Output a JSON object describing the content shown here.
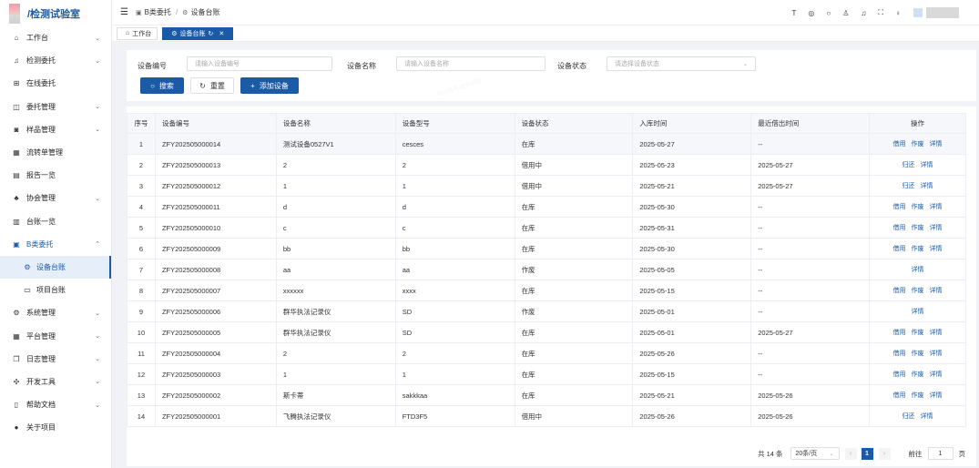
{
  "app": {
    "logo_text": "/检测试验室"
  },
  "sidebar": {
    "items": [
      {
        "label": "工作台",
        "icon": "home-icon",
        "glyph": "⌂",
        "chev": "⌄"
      },
      {
        "label": "检测委托",
        "icon": "bell-icon",
        "glyph": "♫",
        "chev": "⌄"
      },
      {
        "label": "在线委托",
        "icon": "grid-icon",
        "glyph": "⊞",
        "chev": ""
      },
      {
        "label": "委托管理",
        "icon": "bag-icon",
        "glyph": "◫",
        "chev": "⌄"
      },
      {
        "label": "样品管理",
        "icon": "camera-icon",
        "glyph": "◙",
        "chev": "⌄"
      },
      {
        "label": "流转单管理",
        "icon": "apps-icon",
        "glyph": "▦",
        "chev": ""
      },
      {
        "label": "报告一览",
        "icon": "file-icon",
        "glyph": "▤",
        "chev": ""
      },
      {
        "label": "协会管理",
        "icon": "org-icon",
        "glyph": "♣",
        "chev": "⌄"
      },
      {
        "label": "台账一览",
        "icon": "list-icon",
        "glyph": "▥",
        "chev": ""
      },
      {
        "label": "B类委托",
        "icon": "table-icon",
        "glyph": "▣",
        "chev": "⌃"
      }
    ],
    "sub_items": [
      {
        "label": "设备台账",
        "icon": "gear-icon",
        "glyph": "⚙"
      },
      {
        "label": "项目台账",
        "icon": "folder-icon",
        "glyph": "▭"
      }
    ],
    "items_after": [
      {
        "label": "系统管理",
        "icon": "settings-icon",
        "glyph": "⚙",
        "chev": "⌄"
      },
      {
        "label": "平台管理",
        "icon": "apps-icon",
        "glyph": "▦",
        "chev": "⌄"
      },
      {
        "label": "日志管理",
        "icon": "copy-icon",
        "glyph": "❐",
        "chev": "⌄"
      },
      {
        "label": "开发工具",
        "icon": "tool-icon",
        "glyph": "✣",
        "chev": "⌄"
      },
      {
        "label": "帮助文档",
        "icon": "doc-icon",
        "glyph": "▯",
        "chev": "⌄"
      },
      {
        "label": "关于项目",
        "icon": "info-icon",
        "glyph": "●",
        "chev": ""
      }
    ]
  },
  "topbar": {
    "breadcrumb_1": "B类委托",
    "breadcrumb_sep": "/",
    "breadcrumb_2": "设备台账"
  },
  "tabs": {
    "home": "工作台",
    "current": "设备台账"
  },
  "filter": {
    "code_label": "设备编号",
    "code_placeholder": "请输入设备编号",
    "name_label": "设备名称",
    "name_placeholder": "请输入设备名称",
    "status_label": "设备状态",
    "status_placeholder": "请选择设备状态",
    "search_btn": "搜索",
    "reset_btn": "重置",
    "add_btn": "添加设备"
  },
  "table": {
    "headers": [
      "序号",
      "设备编号",
      "设备名称",
      "设备型号",
      "设备状态",
      "入库时间",
      "最近借出时间",
      "操作"
    ],
    "rows": [
      {
        "no": "1",
        "code": "ZFY202505000014",
        "name": "测试设备0527V1",
        "model": "cesces",
        "status": "在库",
        "in_date": "2025-05-27",
        "lend_date": "--",
        "ops": [
          "借用",
          "作废",
          "详情"
        ]
      },
      {
        "no": "2",
        "code": "ZFY202505000013",
        "name": "2",
        "model": "2",
        "status": "借用中",
        "in_date": "2025-05-23",
        "lend_date": "2025-05-27",
        "ops": [
          "归还",
          "详情"
        ]
      },
      {
        "no": "3",
        "code": "ZFY202505000012",
        "name": "1",
        "model": "1",
        "status": "借用中",
        "in_date": "2025-05-21",
        "lend_date": "2025-05-27",
        "ops": [
          "归还",
          "详情"
        ]
      },
      {
        "no": "4",
        "code": "ZFY202505000011",
        "name": "d",
        "model": "d",
        "status": "在库",
        "in_date": "2025-05-30",
        "lend_date": "--",
        "ops": [
          "借用",
          "作废",
          "详情"
        ]
      },
      {
        "no": "5",
        "code": "ZFY202505000010",
        "name": "c",
        "model": "c",
        "status": "在库",
        "in_date": "2025-05-31",
        "lend_date": "--",
        "ops": [
          "借用",
          "作废",
          "详情"
        ]
      },
      {
        "no": "6",
        "code": "ZFY202505000009",
        "name": "bb",
        "model": "bb",
        "status": "在库",
        "in_date": "2025-05-30",
        "lend_date": "--",
        "ops": [
          "借用",
          "作废",
          "详情"
        ]
      },
      {
        "no": "7",
        "code": "ZFY202505000008",
        "name": "aa",
        "model": "aa",
        "status": "作废",
        "in_date": "2025-05-05",
        "lend_date": "--",
        "ops": [
          "详情"
        ]
      },
      {
        "no": "8",
        "code": "ZFY202505000007",
        "name": "xxxxxx",
        "model": "xxxx",
        "status": "在库",
        "in_date": "2025-05-15",
        "lend_date": "--",
        "ops": [
          "借用",
          "作废",
          "详情"
        ]
      },
      {
        "no": "9",
        "code": "ZFY202505000006",
        "name": "群华执法记录仪",
        "model": "SD",
        "status": "作废",
        "in_date": "2025-05-01",
        "lend_date": "--",
        "ops": [
          "详情"
        ]
      },
      {
        "no": "10",
        "code": "ZFY202505000005",
        "name": "群华执法记录仪",
        "model": "SD",
        "status": "在库",
        "in_date": "2025-05-01",
        "lend_date": "2025-05-27",
        "ops": [
          "借用",
          "作废",
          "详情"
        ]
      },
      {
        "no": "11",
        "code": "ZFY202505000004",
        "name": "2",
        "model": "2",
        "status": "在库",
        "in_date": "2025-05-26",
        "lend_date": "--",
        "ops": [
          "借用",
          "作废",
          "详情"
        ]
      },
      {
        "no": "12",
        "code": "ZFY202505000003",
        "name": "1",
        "model": "1",
        "status": "在库",
        "in_date": "2025-05-15",
        "lend_date": "--",
        "ops": [
          "借用",
          "作废",
          "详情"
        ]
      },
      {
        "no": "13",
        "code": "ZFY202505000002",
        "name": "斯卡蒂",
        "model": "sakkkaa",
        "status": "在库",
        "in_date": "2025-05-21",
        "lend_date": "2025-05-26",
        "ops": [
          "借用",
          "作废",
          "详情"
        ]
      },
      {
        "no": "14",
        "code": "ZFY202505000001",
        "name": "飞腾执法记录仪",
        "model": "FTD3F5",
        "status": "借用中",
        "in_date": "2025-05-26",
        "lend_date": "2025-05-26",
        "ops": [
          "归还",
          "详情"
        ]
      }
    ]
  },
  "pager": {
    "total": "共 14 条",
    "page_size": "20条/页",
    "current_page": "1",
    "goto_label": "前往",
    "goto_value": "1",
    "page_unit": "页"
  },
  "colors": {
    "primary": "#1a5aa6",
    "danger": "#e02020"
  }
}
